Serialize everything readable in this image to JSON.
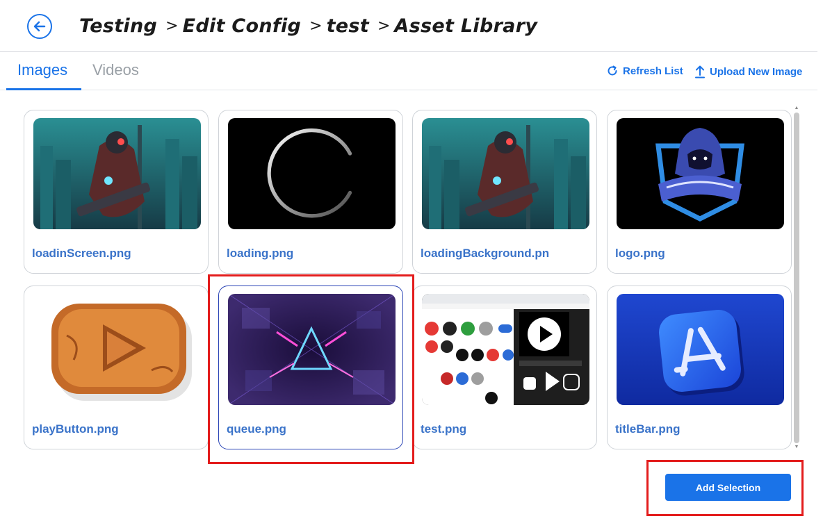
{
  "header": {
    "breadcrumb": [
      "Testing",
      "Edit Config",
      "test",
      "Asset Library"
    ],
    "separator": ">",
    "back_icon": "arrow-left-circle-icon"
  },
  "tabs": [
    {
      "label": "Images",
      "active": true
    },
    {
      "label": "Videos",
      "active": false
    }
  ],
  "actions": {
    "refresh_label": "Refresh List",
    "refresh_icon": "refresh-icon",
    "upload_label": "Upload New Image",
    "upload_icon": "upload-icon"
  },
  "assets": [
    {
      "name": "loadinScreen.png",
      "thumb": "cyber-soldier"
    },
    {
      "name": "loading.png",
      "thumb": "loading-ring"
    },
    {
      "name": "loadingBackground.pn",
      "thumb": "cyber-soldier"
    },
    {
      "name": "logo.png",
      "thumb": "hooded-mascot"
    },
    {
      "name": "playButton.png",
      "thumb": "wooden-play-button"
    },
    {
      "name": "queue.png",
      "thumb": "neon-triangle-tunnel",
      "selected": true
    },
    {
      "name": "test.png",
      "thumb": "screenshot-collage"
    },
    {
      "name": "titleBar.png",
      "thumb": "app-store-icon"
    }
  ],
  "footer": {
    "add_selection_label": "Add Selection"
  },
  "colors": {
    "accent": "#1a73e8",
    "filename": "#3a73c9",
    "highlight": "#e31c1c"
  }
}
